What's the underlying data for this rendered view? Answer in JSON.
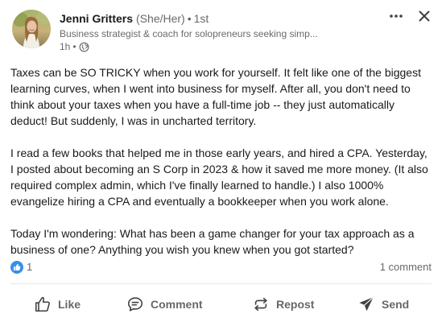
{
  "author": {
    "name": "Jenni Gritters",
    "pronouns": "(She/Her)",
    "separator": "•",
    "degree": "1st",
    "headline": "Business strategist & coach for solopreneurs seeking simp...",
    "time": "1h",
    "time_separator": "•",
    "visibility_icon": "globe-icon"
  },
  "post": {
    "paragraphs": [
      "Taxes can be SO TRICKY when you work for yourself. It felt like one of the biggest learning curves, when I went into business for myself. After all, you don't need to think about your taxes when you have a full-time job -- they just automatically deduct! But suddenly, I was in uncharted territory.",
      "I read a few books that helped me in those early years, and hired a CPA. Yesterday, I posted about becoming an S Corp in 2023 & how it saved me more money. (It also required complex admin, which I've finally learned to handle.) I also 1000% evangelize hiring a CPA and eventually a bookkeeper when you work alone.",
      "Today I'm wondering: What has been a game changer for your tax approach as a business of one? Anything you wish you knew when you got started?"
    ]
  },
  "social": {
    "reaction_icon": "like-reaction-icon",
    "reaction_count": "1",
    "comment_count": "1 comment"
  },
  "actions": {
    "like": "Like",
    "comment": "Comment",
    "repost": "Repost",
    "send": "Send"
  },
  "colors": {
    "like_blue": "#378fe9",
    "text_primary": "#191919",
    "text_secondary": "#666666",
    "divider": "#e8e8e8"
  }
}
